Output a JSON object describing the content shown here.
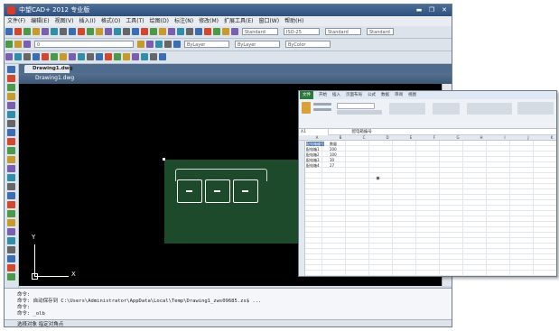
{
  "cad": {
    "title": "中望CAD+ 2012 专业版",
    "menus": [
      "文件(F)",
      "编辑(E)",
      "视图(V)",
      "插入(I)",
      "格式(O)",
      "工具(T)",
      "绘图(D)",
      "标注(N)",
      "修改(M)",
      "扩展工具(E)",
      "窗口(W)",
      "帮助(H)"
    ],
    "toolbar_combos": [
      "Standard",
      "ISO-25",
      "Standard",
      "Standard",
      "ByLayer",
      "ByLayer",
      "ByColor"
    ],
    "layer_value": "0",
    "doc_tab": "Drawing1.dwg",
    "drawing_title": "Drawing1.dwg",
    "axis_y": "Y",
    "axis_x": "X",
    "command_lines": [
      "命令:",
      "命令: 自动保存到 C:\\Users\\Administrator\\AppData\\Local\\Temp\\Drawing1_zws09685.zs$ ...",
      "命令:",
      "命令: _olb"
    ],
    "status_text": "选择对象  指定对角点"
  },
  "excel": {
    "tabs": [
      "文件",
      "开始",
      "插入",
      "页面布局",
      "公式",
      "数据",
      "审阅",
      "视图"
    ],
    "name_box": "A1",
    "formula": "配电箱编号",
    "columns": [
      "A",
      "B",
      "C",
      "D",
      "E",
      "F",
      "G",
      "H",
      "I",
      "J",
      "K"
    ],
    "cells": [
      [
        "配电箱编号",
        "数量"
      ],
      [
        "配电箱1",
        "200"
      ],
      [
        "配电箱2",
        "100"
      ],
      [
        "配电箱3",
        "30"
      ],
      [
        "配电箱4",
        "27"
      ]
    ]
  },
  "colors": {
    "accent": "#2f507c",
    "excel_green": "#2c7a3c",
    "cad_green": "#1c4a2a"
  }
}
